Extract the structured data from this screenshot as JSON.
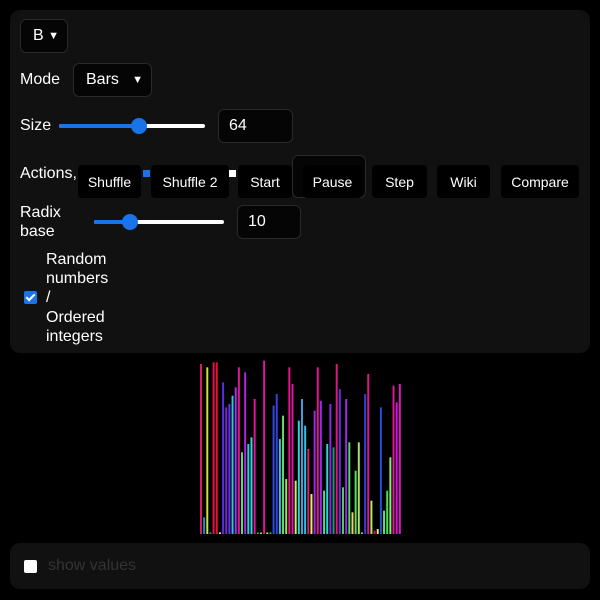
{
  "controls": {
    "algorithm": {
      "selected": "B"
    },
    "mode": {
      "label": "Mode",
      "selected": "Bars"
    },
    "size": {
      "label": "Size",
      "value": "64",
      "slider_fraction": 0.55
    },
    "actions": {
      "label": "Actions",
      "buttons": [
        "Shuffle",
        "Shuffle 2",
        "Start",
        "Pause",
        "Step",
        "Wiki",
        "Compare"
      ]
    },
    "radix": {
      "label_line1": "Radix",
      "label_line2": "base",
      "value": "10",
      "slider_fraction": 0.28
    },
    "random_toggle": {
      "checked": true,
      "label_lines": [
        "Random",
        "numbers",
        "/",
        "Ordered",
        "integers"
      ]
    }
  },
  "footer": {
    "show_values_label": "show values",
    "checked": false
  },
  "colors": {
    "accent": "#1a73e8",
    "panel_bg": "#111111",
    "page_bg": "#000000"
  },
  "chart_data": {
    "type": "bar",
    "values": [
      102,
      10,
      100,
      1,
      103,
      103,
      1,
      91,
      76,
      78,
      83,
      88,
      100,
      49,
      97,
      54,
      58,
      81,
      0,
      0,
      104,
      0,
      0,
      77,
      84,
      57,
      71,
      33,
      100,
      90,
      32,
      68,
      81,
      65,
      51,
      24,
      74,
      100,
      80,
      26,
      54,
      78,
      52,
      102,
      87,
      28,
      81,
      55,
      13,
      38,
      55,
      1,
      84,
      96,
      20,
      2,
      3,
      76,
      14,
      26,
      46,
      89,
      79,
      90
    ],
    "colors": [
      "#e0186c",
      "#1d8ec8",
      "#d2e23c",
      "#1fa858",
      "#e8124a",
      "#e81232",
      "#f0f07c",
      "#5a2ee0",
      "#7c22d8",
      "#6a34ee",
      "#28c8e0",
      "#a038e8",
      "#e01894",
      "#58e278",
      "#b422e0",
      "#2ad0d8",
      "#3ed4de",
      "#e0189e",
      "#2ecc5c",
      "#7cf060",
      "#e014a2",
      "#d6e83c",
      "#14de54",
      "#3248e0",
      "#3046e8",
      "#26cce6",
      "#6adc64",
      "#90ea60",
      "#e8148a",
      "#dc18a8",
      "#c8f060",
      "#2ad6d4",
      "#3ea0e8",
      "#2cc4e2",
      "#e0186e",
      "#ecf068",
      "#a22ae0",
      "#e81496",
      "#9a28e0",
      "#3ce686",
      "#32d4ce",
      "#8c2ae0",
      "#1a9c6c",
      "#dc1884",
      "#6e28e0",
      "#48d06a",
      "#a02ae8",
      "#52da66",
      "#f6d070",
      "#5cde60",
      "#a8e66a",
      "#72d850",
      "#4434e0",
      "#e0188a",
      "#b0f060",
      "#e0147e",
      "#ecee62",
      "#2052e0",
      "#5ce278",
      "#40e454",
      "#88f070",
      "#e0189a",
      "#d612e4",
      "#e018c4"
    ],
    "ylim": [
      0,
      105
    ]
  }
}
